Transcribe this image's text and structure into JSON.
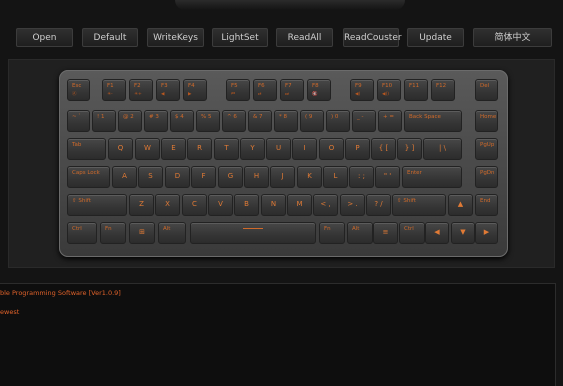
{
  "toolbar": {
    "buttons": [
      {
        "id": "open",
        "label": "Open"
      },
      {
        "id": "default",
        "label": "Default"
      },
      {
        "id": "writekeys",
        "label": "WriteKeys"
      },
      {
        "id": "lightset",
        "label": "LightSet"
      },
      {
        "id": "readall",
        "label": "ReadAll"
      },
      {
        "id": "readcounter",
        "label": "ReadCouster"
      },
      {
        "id": "update",
        "label": "Update"
      },
      {
        "id": "language",
        "label": "简体中文"
      }
    ]
  },
  "keyboard": {
    "rows": [
      [
        {
          "p": "Esc",
          "s": "Ⓐ"
        },
        {
          "p": "F1",
          "s": "☀-"
        },
        {
          "p": "F2",
          "s": "☀+"
        },
        {
          "p": "F3",
          "s": "◀"
        },
        {
          "p": "F4",
          "s": "▶"
        },
        {
          "p": "F5",
          "s": "⏮"
        },
        {
          "p": "F6",
          "s": "⏯"
        },
        {
          "p": "F7",
          "s": "⏭"
        },
        {
          "p": "F8",
          "s": "🔇"
        },
        {
          "p": "F9",
          "s": "◀)"
        },
        {
          "p": "F10",
          "s": "◀))"
        },
        {
          "p": "F11",
          "s": ""
        },
        {
          "p": "F12",
          "s": ""
        },
        {
          "p": "Del",
          "s": ""
        }
      ],
      [
        {
          "p": "~ `",
          "s": ""
        },
        {
          "p": "! 1",
          "s": ""
        },
        {
          "p": "@ 2",
          "s": ""
        },
        {
          "p": "# 3",
          "s": ""
        },
        {
          "p": "$ 4",
          "s": ""
        },
        {
          "p": "% 5",
          "s": ""
        },
        {
          "p": "^ 6",
          "s": ""
        },
        {
          "p": "& 7",
          "s": ""
        },
        {
          "p": "* 8",
          "s": ""
        },
        {
          "p": "( 9",
          "s": ""
        },
        {
          "p": ") 0",
          "s": ""
        },
        {
          "p": "_ -",
          "s": ""
        },
        {
          "p": "+ =",
          "s": ""
        },
        {
          "p": "Back Space",
          "s": ""
        },
        {
          "p": "Home",
          "s": ""
        }
      ],
      [
        {
          "p": "Tab",
          "s": ""
        },
        {
          "c": "Q"
        },
        {
          "c": "W"
        },
        {
          "c": "E"
        },
        {
          "c": "R"
        },
        {
          "c": "T"
        },
        {
          "c": "Y"
        },
        {
          "c": "U"
        },
        {
          "c": "I"
        },
        {
          "c": "O"
        },
        {
          "c": "P"
        },
        {
          "c": "{ ["
        },
        {
          "c": "} ]"
        },
        {
          "c": "| \\"
        },
        {
          "p": "PgUp",
          "s": ""
        }
      ],
      [
        {
          "p": "Caps Lock",
          "s": ""
        },
        {
          "c": "A"
        },
        {
          "c": "S"
        },
        {
          "c": "D"
        },
        {
          "c": "F"
        },
        {
          "c": "G"
        },
        {
          "c": "H"
        },
        {
          "c": "J"
        },
        {
          "c": "K"
        },
        {
          "c": "L"
        },
        {
          "c": ": ;"
        },
        {
          "c": "\" '"
        },
        {
          "p": "Enter",
          "s": ""
        },
        {
          "p": "PgDn",
          "s": ""
        }
      ],
      [
        {
          "p": "⇧ Shift",
          "s": ""
        },
        {
          "c": "Z"
        },
        {
          "c": "X"
        },
        {
          "c": "C"
        },
        {
          "c": "V"
        },
        {
          "c": "B"
        },
        {
          "c": "N"
        },
        {
          "c": "M"
        },
        {
          "c": "< ,"
        },
        {
          "c": "> ."
        },
        {
          "c": "? /"
        },
        {
          "p": "⇧ Shift",
          "s": ""
        },
        {
          "c": "▲"
        },
        {
          "p": "End",
          "s": ""
        }
      ],
      [
        {
          "p": "Ctrl",
          "s": ""
        },
        {
          "p": "Fn",
          "s": ""
        },
        {
          "c": "⊞"
        },
        {
          "p": "Alt",
          "s": ""
        },
        {
          "space": true
        },
        {
          "p": "Fn",
          "s": ""
        },
        {
          "p": "Alt",
          "s": ""
        },
        {
          "c": "≡"
        },
        {
          "p": "Ctrl",
          "s": ""
        },
        {
          "c": "◀"
        },
        {
          "c": "▼"
        },
        {
          "c": "▶"
        }
      ]
    ]
  },
  "log": {
    "lines": [
      "ble Programming Software [Ver1.0.9]",
      "ewest"
    ]
  }
}
